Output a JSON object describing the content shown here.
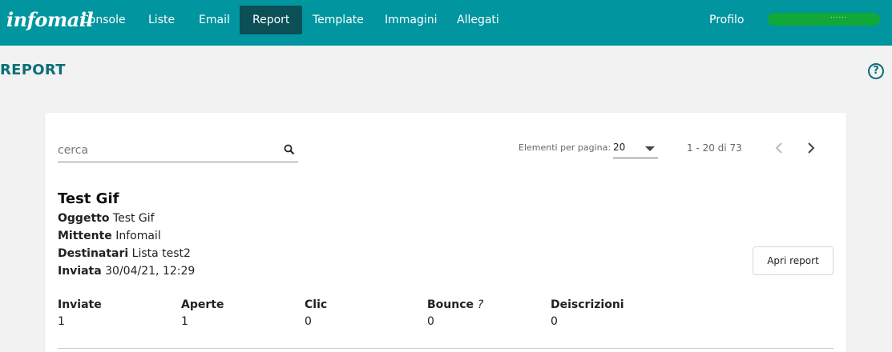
{
  "app": {
    "logo_text": "infomail"
  },
  "nav": {
    "items": [
      {
        "label": "Console"
      },
      {
        "label": "Liste"
      },
      {
        "label": "Email"
      },
      {
        "label": "Report",
        "active": true
      },
      {
        "label": "Template"
      },
      {
        "label": "Immagini"
      },
      {
        "label": "Allegati"
      }
    ],
    "profile_label": "Profilo",
    "user_name": "......"
  },
  "page": {
    "title": "REPORT",
    "help_icon": "help-circle-icon"
  },
  "search": {
    "placeholder": "cerca",
    "value": ""
  },
  "pagination": {
    "per_page_label": "Elementi per pagina:",
    "per_page_value": "20",
    "range_text": "1 - 20 di 73"
  },
  "report": {
    "title": "Test Gif",
    "fields": [
      {
        "label": "Oggetto",
        "value": "Test Gif"
      },
      {
        "label": "Mittente",
        "value": "Infomail"
      },
      {
        "label": "Destinatari",
        "value": "Lista test2"
      },
      {
        "label": "Inviata",
        "value": "30/04/21, 12:29"
      }
    ],
    "open_button_label": "Apri report",
    "stats": [
      {
        "label": "Inviate",
        "value": "1"
      },
      {
        "label": "Aperte",
        "value": "1"
      },
      {
        "label": "Clic",
        "value": "0"
      },
      {
        "label": "Bounce",
        "suffix": "?",
        "value": "0"
      },
      {
        "label": "Deiscrizioni",
        "value": "0"
      }
    ]
  },
  "colors": {
    "topbar": "#00959f",
    "nav_active": "#0b4f57",
    "title": "#0b6f78",
    "background": "#f2f2f2"
  }
}
